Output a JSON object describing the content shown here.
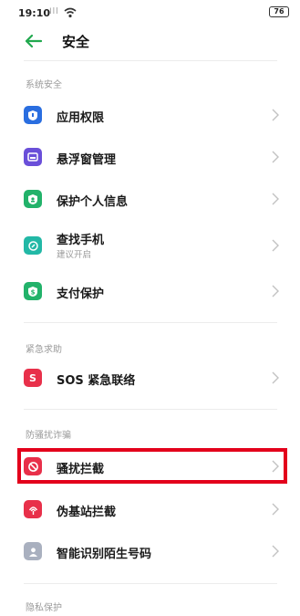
{
  "status_bar": {
    "time": "19:10",
    "signal_text": "Ill",
    "battery": "76"
  },
  "header": {
    "title": "安全"
  },
  "sections": [
    {
      "title": "系统安全",
      "items": [
        {
          "label": "应用权限",
          "icon": "shield-icon",
          "color": "#2a6ee0"
        },
        {
          "label": "悬浮窗管理",
          "icon": "window-icon",
          "color": "#6a4fd9"
        },
        {
          "label": "保护个人信息",
          "icon": "privacy-shield-icon",
          "color": "#22b26a"
        },
        {
          "label": "查找手机",
          "subtitle": "建议开启",
          "icon": "locate-icon",
          "color": "#22b8a6"
        },
        {
          "label": "支付保护",
          "icon": "payment-shield-icon",
          "color": "#22b26a"
        }
      ]
    },
    {
      "title": "紧急求助",
      "items": [
        {
          "label": "SOS 紧急联络",
          "icon": "sos-icon",
          "icon_text": "S",
          "color": "#e8304a"
        }
      ]
    },
    {
      "title": "防骚扰诈骗",
      "items": [
        {
          "label": "骚扰拦截",
          "icon": "block-icon",
          "color": "#e8304a",
          "highlighted": true
        },
        {
          "label": "伪基站拦截",
          "icon": "antenna-icon",
          "color": "#e8304a"
        },
        {
          "label": "智能识别陌生号码",
          "icon": "contact-icon",
          "color": "#a9b0bf"
        }
      ]
    },
    {
      "title": "隐私保护",
      "items": []
    }
  ],
  "colors": {
    "accent_back": "#22a94f",
    "highlight_border": "#e3001b"
  }
}
